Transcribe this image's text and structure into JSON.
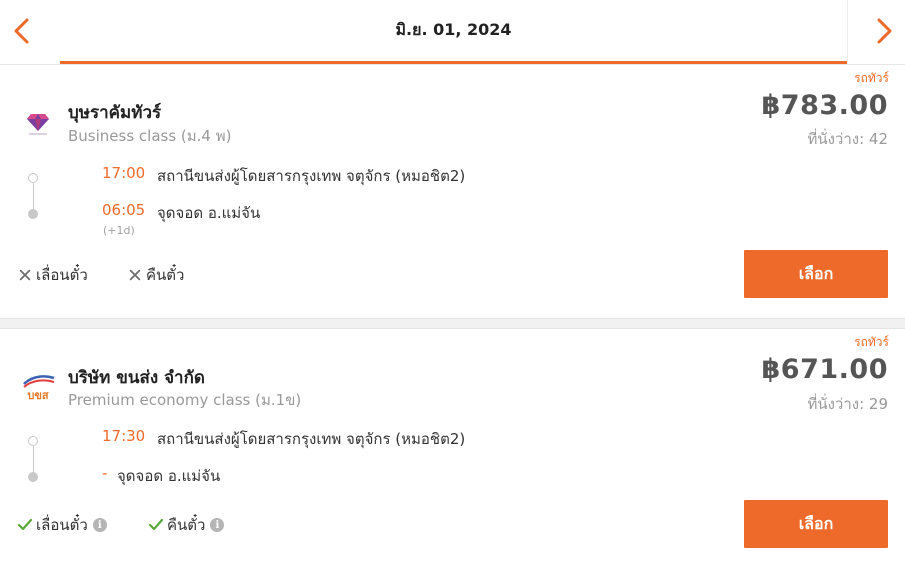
{
  "header": {
    "date": "มิ.ย. 01, 2024"
  },
  "colors": {
    "accent": "#ee6a2a",
    "muted": "#9a9a9a"
  },
  "results": [
    {
      "badge": "รถทัวร์",
      "company": "บุษราคัมทัวร์",
      "class": "Business class (ม.4 พ)",
      "price": "฿783.00",
      "seats": "ที่นั่งว่าง: 42",
      "depart_time": "17:00",
      "depart_stop": "สถานีขนส่งผู้โดยสารกรุงเทพ จตุจักร (หมอชิต2)",
      "arrive_time": "06:05",
      "arrive_stop": "จุดจอด อ.แม่จัน",
      "day_offset": "(+1d)",
      "reschedule": "เลื่อนตั๋ว",
      "refund": "คืนตั๋ว",
      "select": "เลือก",
      "logo_icon": "diamond-logo-icon"
    },
    {
      "badge": "รถทัวร์",
      "company": "บริษัท ขนส่ง จำกัด",
      "class": "Premium economy class (ม.1ข)",
      "price": "฿671.00",
      "seats": "ที่นั่งว่าง: 29",
      "depart_time": "17:30",
      "depart_stop": "สถานีขนส่งผู้โดยสารกรุงเทพ จตุจักร (หมอชิต2)",
      "arrive_time": "-",
      "arrive_stop": "จุดจอด อ.แม่จัน",
      "reschedule": "เลื่อนตั๋ว",
      "refund": "คืนตั๋ว",
      "info_mark": "i",
      "select": "เลือก",
      "logo_text": "บขส",
      "logo_icon": "bks-logo-icon"
    }
  ]
}
